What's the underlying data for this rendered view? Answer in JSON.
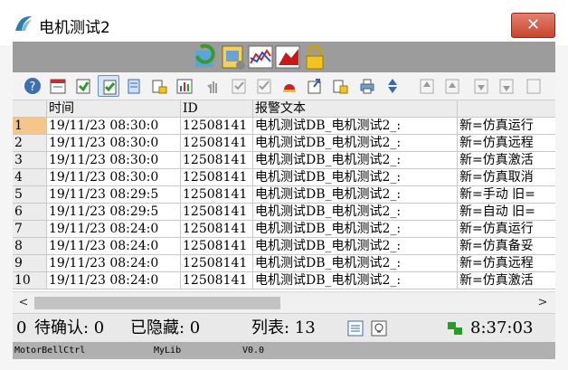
{
  "window": {
    "title": "电机测试2"
  },
  "toolbar_icons": [
    "help-icon",
    "calendar-icon",
    "refresh-icon",
    "acknowledge-icon",
    "stack-icon",
    "lock-icon",
    "chart-icon",
    "hand-icon",
    "check-icon",
    "check-all-icon",
    "alarm-icon",
    "export-icon",
    "lock-edit-icon",
    "print-icon",
    "sort-icon",
    "first-icon",
    "prev-icon",
    "next-icon",
    "last-icon",
    "more-icon"
  ],
  "table": {
    "headers": [
      "",
      "时间",
      "ID",
      "报警文本",
      ""
    ],
    "rows": [
      {
        "n": "1",
        "time": "19/11/23 08:30:0",
        "id": "12508141",
        "text": "电机测试DB_电机测试2_:",
        "extra": "新=仿真运行"
      },
      {
        "n": "2",
        "time": "19/11/23 08:30:0",
        "id": "12508141",
        "text": "电机测试DB_电机测试2_:",
        "extra": "新=仿真远程"
      },
      {
        "n": "3",
        "time": "19/11/23 08:30:0",
        "id": "12508141",
        "text": "电机测试DB_电机测试2_:",
        "extra": "新=仿真激活"
      },
      {
        "n": "4",
        "time": "19/11/23 08:30:0",
        "id": "12508141",
        "text": "电机测试DB_电机测试2_:",
        "extra": "新=仿真取消"
      },
      {
        "n": "5",
        "time": "19/11/23 08:29:5",
        "id": "12508141",
        "text": "电机测试DB_电机测试2_:",
        "extra": "新=手动  旧="
      },
      {
        "n": "6",
        "time": "19/11/23 08:29:5",
        "id": "12508141",
        "text": "电机测试DB_电机测试2_:",
        "extra": "新=自动  旧="
      },
      {
        "n": "7",
        "time": "19/11/23 08:24:0",
        "id": "12508141",
        "text": "电机测试DB_电机测试2_:",
        "extra": "新=仿真运行"
      },
      {
        "n": "8",
        "time": "19/11/23 08:24:0",
        "id": "12508141",
        "text": "电机测试DB_电机测试2_:",
        "extra": "新=仿真备妥"
      },
      {
        "n": "9",
        "time": "19/11/23 08:24:0",
        "id": "12508141",
        "text": "电机测试DB_电机测试2_:",
        "extra": "新=仿真远程"
      },
      {
        "n": "10",
        "time": "19/11/23 08:24:0",
        "id": "12508141",
        "text": "电机测试DB_电机测试2_:",
        "extra": "新=仿真激活"
      }
    ]
  },
  "status": {
    "count_value": "0",
    "pending_label": "待确认: 0",
    "hidden_label": "已隐藏: 0",
    "list_label": "列表: 13",
    "clock": "8:37:03"
  },
  "footer": {
    "block": "MotorBellCtrl",
    "library": "MyLib",
    "version": "V0.0"
  },
  "colors": {
    "selected_row_marker": "#f5c58a",
    "close_button": "#c8452f",
    "strip": "#9c9c9c"
  }
}
